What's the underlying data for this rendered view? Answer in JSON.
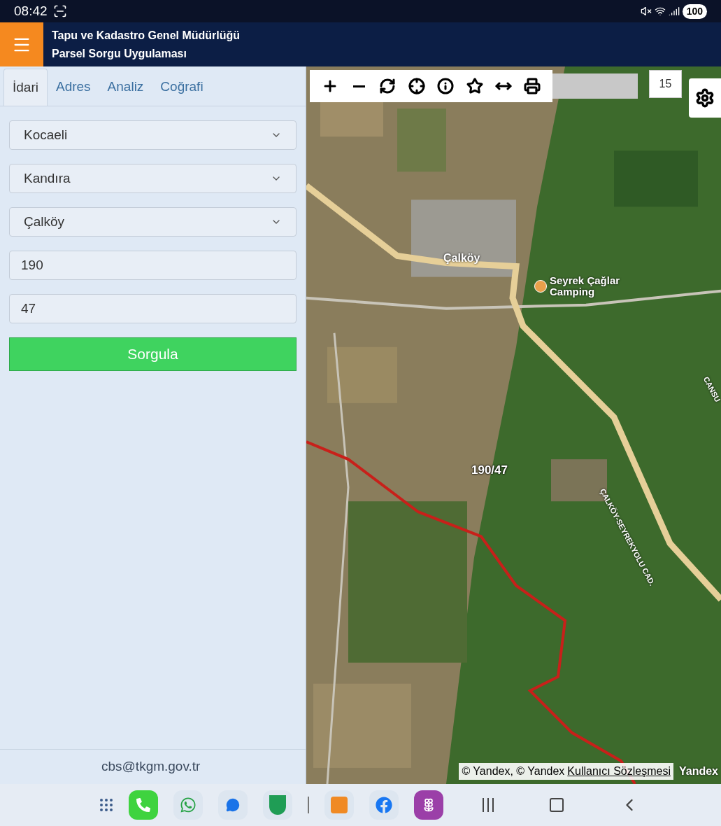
{
  "status_bar": {
    "time": "08:42",
    "battery": "100"
  },
  "header": {
    "title": "Tapu ve Kadastro Genel Müdürlüğü",
    "subtitle": "Parsel Sorgu Uygulaması"
  },
  "tabs": [
    {
      "label": "İdari",
      "selected": true
    },
    {
      "label": "Adres",
      "selected": false
    },
    {
      "label": "Analiz",
      "selected": false
    },
    {
      "label": "Coğrafi",
      "selected": false
    }
  ],
  "form": {
    "selects": [
      {
        "value": "Kocaeli"
      },
      {
        "value": "Kandıra"
      },
      {
        "value": "Çalköy"
      }
    ],
    "inputs": [
      {
        "value": "190"
      },
      {
        "value": "47"
      }
    ],
    "button": "Sorgula"
  },
  "footer": {
    "email": "cbs@tkgm.gov.tr"
  },
  "map": {
    "zoom": "15",
    "labels": [
      {
        "kind": "place",
        "text": "Çalköy"
      },
      {
        "kind": "poi",
        "text": "Seyrek Çağlar Camping"
      },
      {
        "kind": "parcel",
        "text": "190/47"
      },
      {
        "kind": "road",
        "text": "ÇALKÖY-SEYREKYOLU CAD."
      },
      {
        "kind": "road",
        "text": "CANSU"
      }
    ],
    "attribution": {
      "text": "© Yandex, © Yandex",
      "link": "Kullanıcı Sözleşmesi",
      "brand": "Yandex"
    }
  }
}
